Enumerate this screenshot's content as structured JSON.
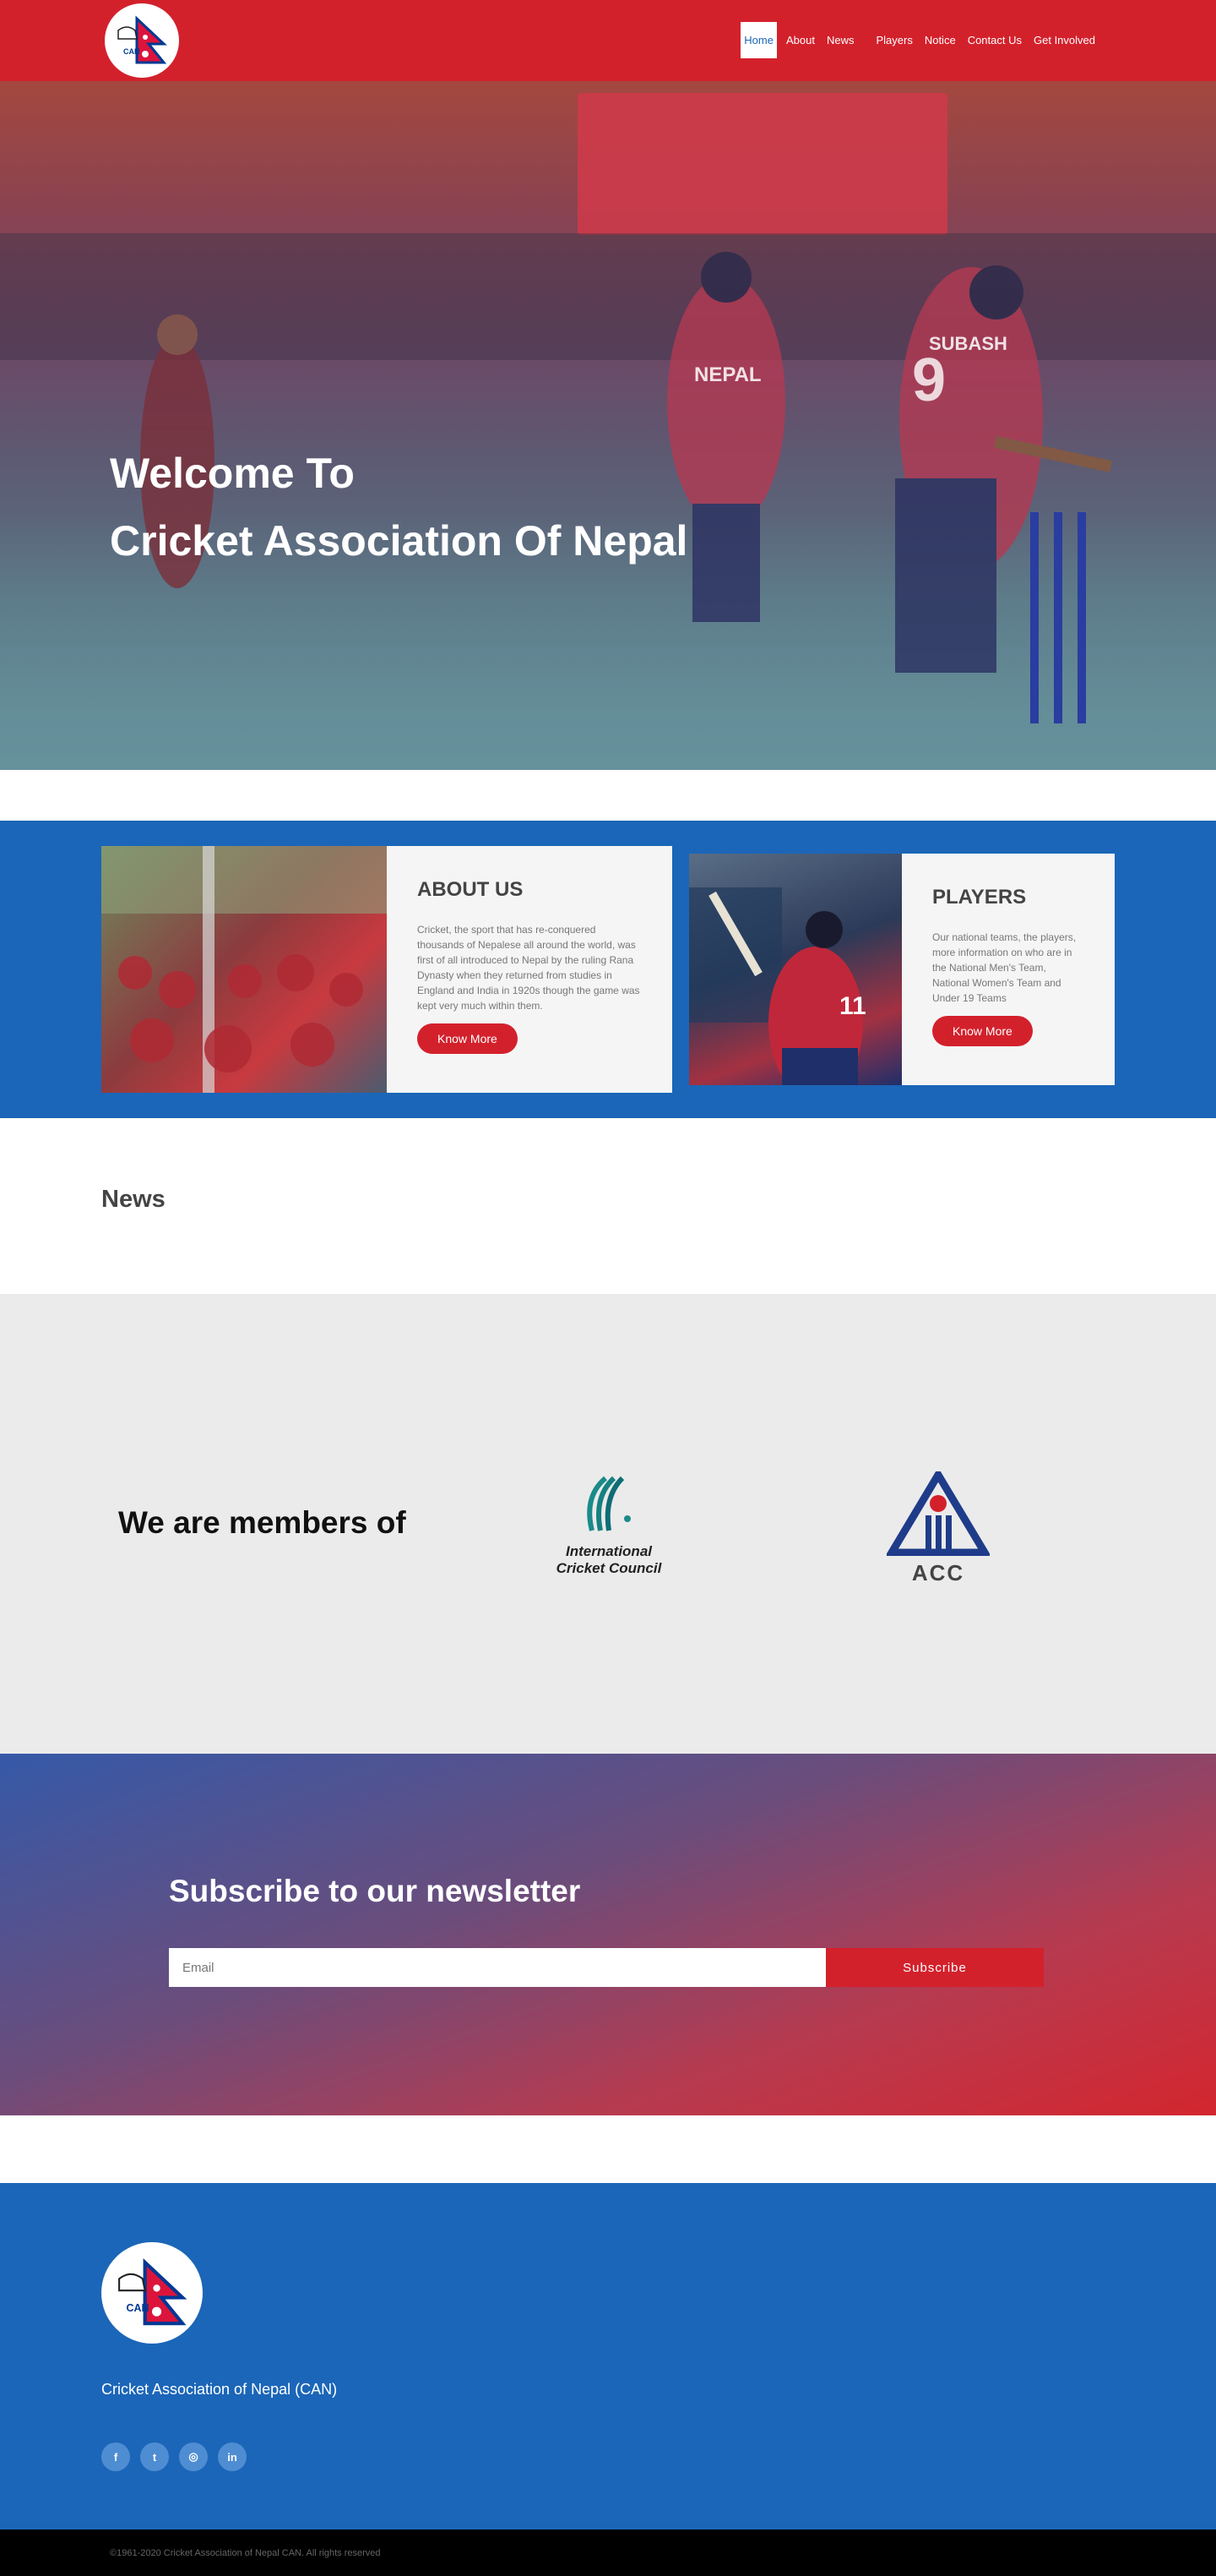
{
  "header": {
    "logo_text": "CAN",
    "nav": [
      "Home",
      "About",
      "News",
      "Players",
      "Notice",
      "Contact Us",
      "Get Involved"
    ]
  },
  "hero": {
    "line1": "Welcome To",
    "line2": "Cricket Association Of Nepal",
    "jersey_text": "NEPAL",
    "jersey_name": "SUBASH",
    "jersey_number": "9"
  },
  "about": {
    "title": "ABOUT US",
    "text": "Cricket, the sport that has re-conquered thousands of Nepalese all around the world, was first of all introduced to Nepal by the ruling Rana Dynasty when they returned from studies in England and India in 1920s though the game was kept very much within them.",
    "button": "Know More"
  },
  "players": {
    "title": "PLAYERS",
    "text": "Our national teams, the players, more information on who are in the National Men's Team, National Women's Team and Under 19 Teams",
    "button": "Know More"
  },
  "news": {
    "title": "News"
  },
  "members": {
    "title": "We are members of",
    "icc_line1": "International",
    "icc_line2": "Cricket Council",
    "acc_text": "ACC"
  },
  "newsletter": {
    "title": "Subscribe to our newsletter",
    "placeholder": "Email",
    "button": "Subscribe"
  },
  "footer": {
    "logo_text": "CAN",
    "org_name": "Cricket Association of Nepal (CAN)",
    "socials": [
      "facebook-icon",
      "twitter-icon",
      "instagram-icon",
      "linkedin-icon"
    ],
    "social_glyphs": [
      "f",
      "t",
      "◎",
      "in"
    ],
    "copyright": "©1961-2020 Cricket Association of Nepal CAN. All rights reserved"
  },
  "colors": {
    "brand_red": "#d3212c",
    "brand_blue": "#1b66b8"
  }
}
